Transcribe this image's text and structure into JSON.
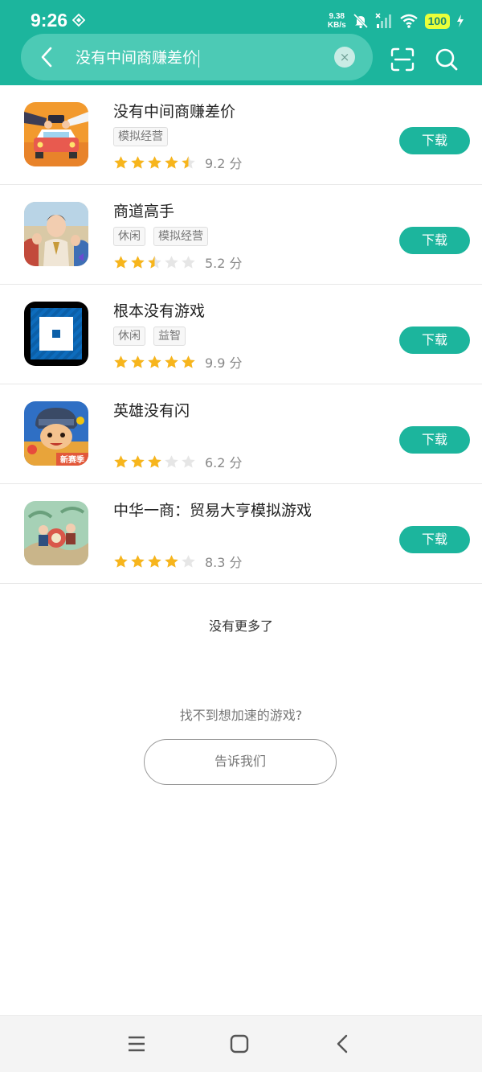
{
  "status_bar": {
    "time": "9:26",
    "net_speed_value": "9.38",
    "net_speed_unit": "KB/s",
    "battery": "100"
  },
  "search": {
    "query": "没有中间商赚差价",
    "clear_symbol": "×"
  },
  "apps": [
    {
      "name": "没有中间商赚差价",
      "tags": [
        "模拟经营"
      ],
      "rating": 4.5,
      "score": "9.2 分",
      "button": "下载"
    },
    {
      "name": "商道高手",
      "tags": [
        "休闲",
        "模拟经营"
      ],
      "rating": 2.5,
      "score": "5.2 分",
      "button": "下载"
    },
    {
      "name": "根本没有游戏",
      "tags": [
        "休闲",
        "益智"
      ],
      "rating": 5,
      "score": "9.9 分",
      "button": "下载"
    },
    {
      "name": "英雄没有闪",
      "tags": [],
      "rating": 3,
      "score": "6.2 分",
      "button": "下载"
    },
    {
      "name": "中华一商：贸易大亨模拟游戏",
      "tags": [],
      "rating": 4,
      "score": "8.3 分",
      "button": "下载"
    }
  ],
  "app_icon_badges": {
    "hero_icon_badge": "新赛季"
  },
  "footer": {
    "no_more": "没有更多了",
    "cant_find": "找不到想加速的游戏?",
    "tell_us": "告诉我们"
  },
  "colors": {
    "accent": "#1cb59d",
    "star_on": "#f7b51c",
    "star_off": "#e6e6e6"
  }
}
